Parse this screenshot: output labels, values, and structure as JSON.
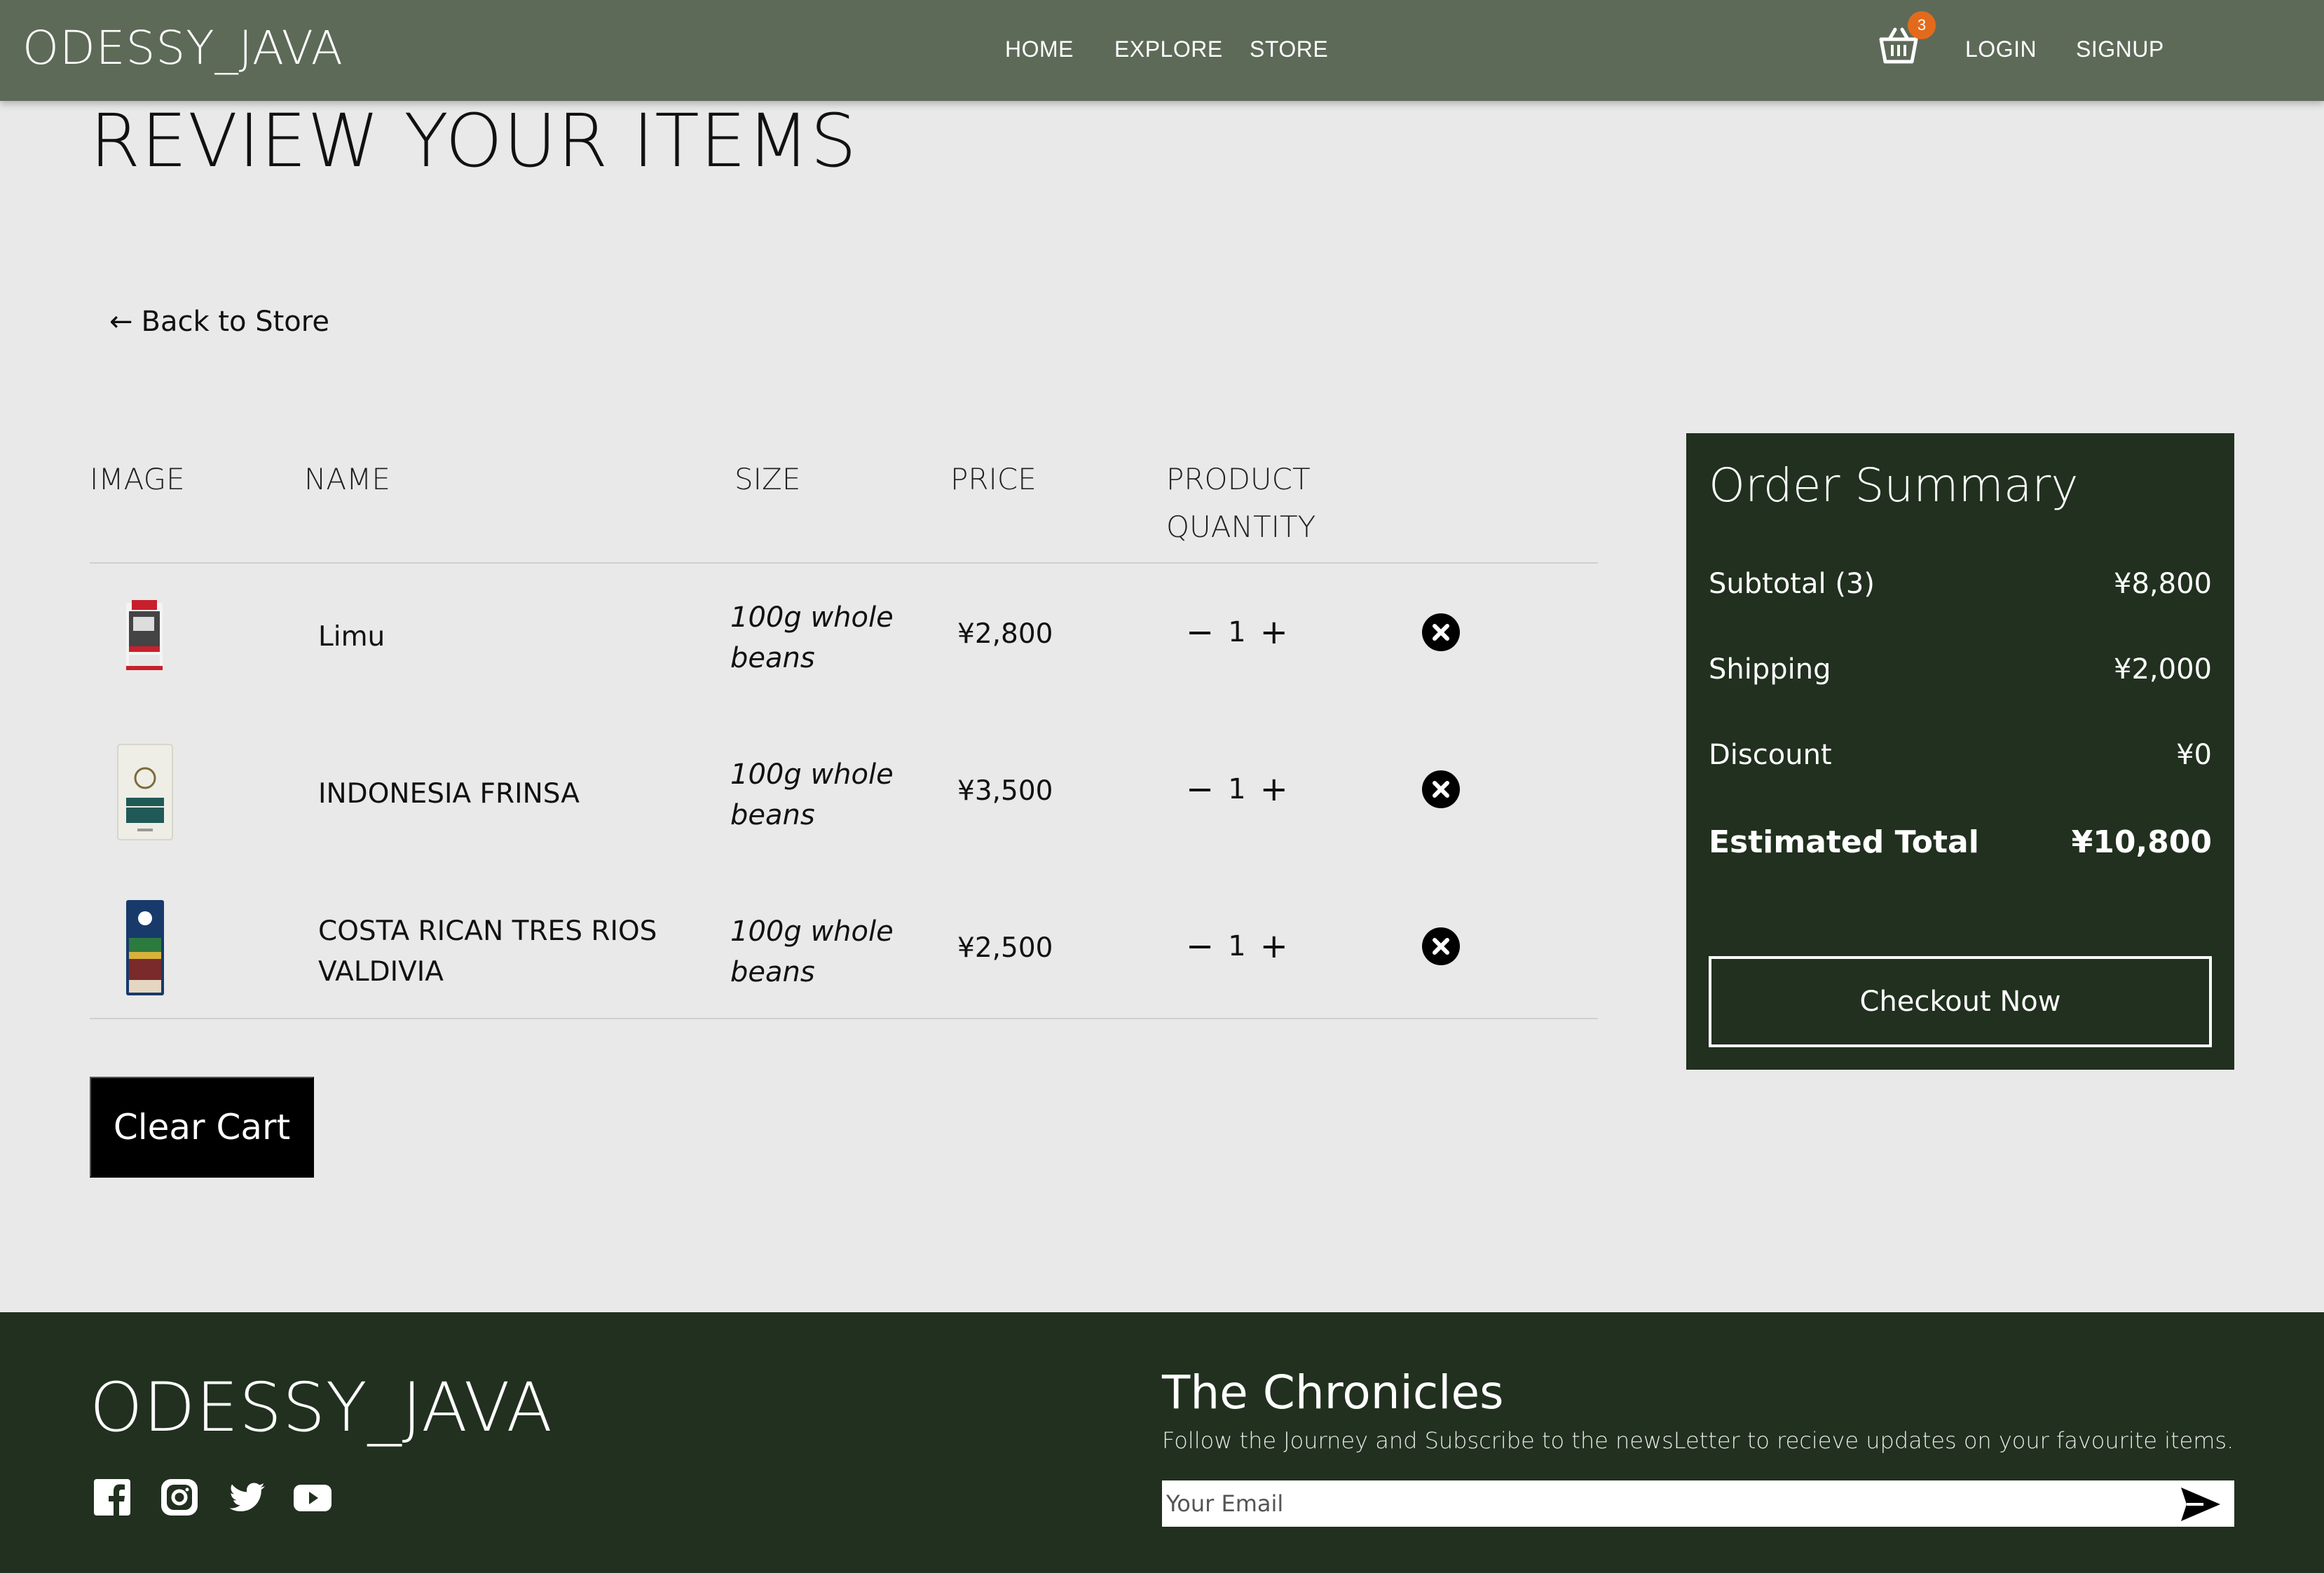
{
  "nav": {
    "brand": "ODESSY_JAVA",
    "links": [
      "HOME",
      "EXPLORE",
      "STORE"
    ],
    "cart_count": "3",
    "login": "LOGIN",
    "signup": "SIGNUP",
    "cart_icon": "basket-icon"
  },
  "page": {
    "title": "REVIEW YOUR ITEMS",
    "back": "Back to Store",
    "back_arrow": "←"
  },
  "table": {
    "headers": {
      "image": "IMAGE",
      "name": "NAME",
      "size": "SIZE",
      "price": "PRICE",
      "quantity_line1": "PRODUCT",
      "quantity_line2": "QUANTITY"
    },
    "rows": [
      {
        "name_line1": "Limu",
        "name_line2": "",
        "size_line1": "100g whole",
        "size_line2": "beans",
        "price": "¥2,800",
        "qty": "1",
        "minus": "−",
        "plus": "+"
      },
      {
        "name_line1": "INDONESIA FRINSA",
        "name_line2": "",
        "size_line1": "100g whole",
        "size_line2": "beans",
        "price": "¥3,500",
        "qty": "1",
        "minus": "−",
        "plus": "+"
      },
      {
        "name_line1": "COSTA RICAN TRES RIOS",
        "name_line2": "VALDIVIA",
        "size_line1": "100g whole",
        "size_line2": "beans",
        "price": "¥2,500",
        "qty": "1",
        "minus": "−",
        "plus": "+"
      }
    ]
  },
  "clear_cart": "Clear Cart",
  "summary": {
    "title": "Order Summary",
    "subtotal_label": "Subtotal (3)",
    "subtotal_value": "¥8,800",
    "shipping_label": "Shipping",
    "shipping_value": "¥2,000",
    "discount_label": "Discount",
    "discount_value": "¥0",
    "total_label": "Estimated Total",
    "total_value": "¥10,800",
    "checkout": "Checkout Now"
  },
  "footer": {
    "brand": "ODESSY_JAVA",
    "social_icons": [
      "facebook-icon",
      "instagram-icon",
      "twitter-icon",
      "youtube-icon"
    ],
    "chronicles_title": "The Chronicles",
    "chronicles_text": "Follow the Journey and Subscribe to the newsLetter to recieve updates on your favourite items.",
    "email_placeholder": "Your Email"
  },
  "colors": {
    "navbar": "#5d6a58",
    "dark_green": "#21301f",
    "badge": "#e46a1b",
    "background": "#e9e9e9"
  }
}
